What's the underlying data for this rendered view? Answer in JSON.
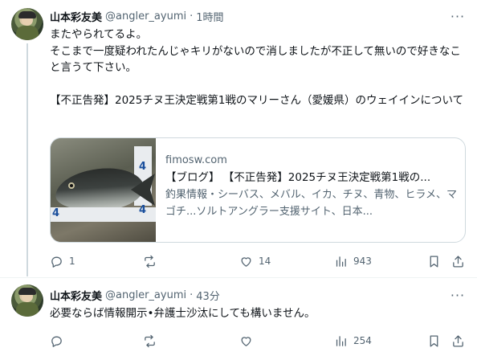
{
  "tweets": [
    {
      "author_name": "山本彩友美",
      "handle": "@angler_ayumi",
      "separator": "·",
      "time": "1時間",
      "more": "···",
      "text": "またやられてるよ。\nそこまで一度疑われたんじゃキリがないので消しましたが不正して無いので好きなこと言うて下さい。\n\n【不正告発】2025チヌ王決定戦第1戦のマリーさん（愛媛県）のウェイインについて",
      "card": {
        "image_labels": [
          "4",
          "4",
          "4"
        ],
        "domain": "fimosw.com",
        "title": "【ブログ】 【不正告発】2025チヌ王決定戦第1戦の...",
        "description": "釣果情報・シーバス、メバル、イカ、チヌ、青物、ヒラメ、マゴチ...ソルトアングラー支援サイト、日本..."
      },
      "actions": {
        "replies": "1",
        "reposts": "",
        "likes": "14",
        "views": "943"
      }
    },
    {
      "author_name": "山本彩友美",
      "handle": "@angler_ayumi",
      "separator": "·",
      "time": "43分",
      "more": "···",
      "text": "必要ならば情報開示•弁護士沙汰にしても構いません。",
      "actions": {
        "replies": "",
        "reposts": "",
        "likes": "",
        "views": "254"
      }
    }
  ]
}
